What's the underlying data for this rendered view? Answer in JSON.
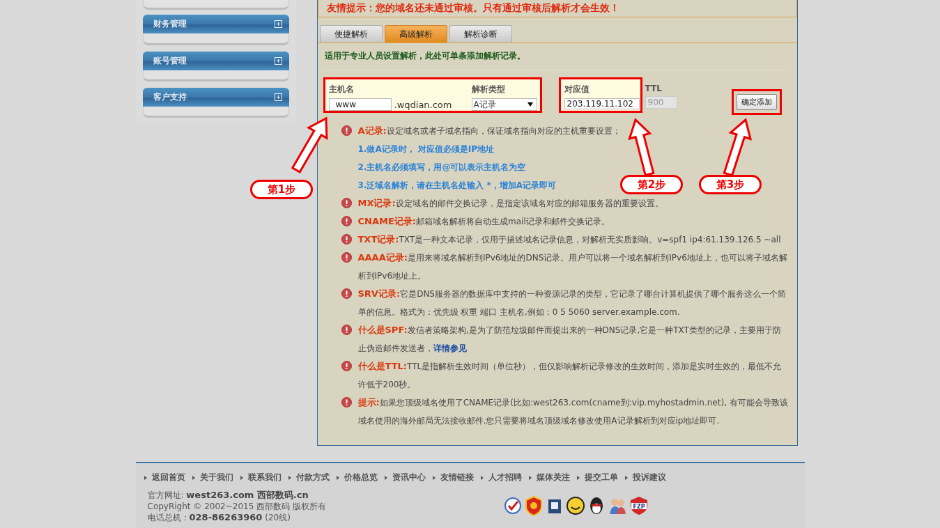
{
  "sidebar": {
    "groups": [
      {
        "title": "财务管理",
        "expanded": false
      },
      {
        "title": "账号管理",
        "expanded": false
      },
      {
        "title": "客户支持",
        "expanded": false
      }
    ]
  },
  "notice": "友情提示：您的域名还未通过审核。只有通过审核后解析才会生效！",
  "tabs": [
    {
      "label": "便捷解析",
      "selected": false
    },
    {
      "label": "高级解析",
      "selected": true
    },
    {
      "label": "解析诊断",
      "selected": false
    }
  ],
  "intro": "适用于专业人员设置解析，此处可单条添加解析记录。",
  "form": {
    "host_label": "主机名",
    "host_value": "www",
    "domain_suffix": ".wqdian.com",
    "type_label": "解析类型",
    "type_value": "A记录",
    "value_label": "对应值",
    "value_value": "203.119.11.102",
    "ttl_label": "TTL",
    "ttl_value": "900",
    "ttl_disabled": true,
    "submit": "确定添加"
  },
  "items": [
    {
      "title": "A记录:",
      "text": "设定域名或者子域名指向，保证域名指向对应的主机重要设置；",
      "notes": [
        "1.做A记录时， 对应值必须是IP地址",
        "2.主机名必须填写，用@可以表示主机名为空",
        "3.泛域名解析，请在主机名处输入 *，增加A记录即可"
      ]
    },
    {
      "title": "MX记录:",
      "text": "设定域名的邮件交换记录，是指定该域名对应的邮箱服务器的重要设置。"
    },
    {
      "title": "CNAME记录:",
      "text": "邮箱域名解析将自动生成mail记录和邮件交换记录。"
    },
    {
      "title": "TXT记录:",
      "text": "TXT是一种文本记录，仅用于描述域名记录信息，对解析无实质影响。v=spf1 ip4:61.139.126.5 ~all"
    },
    {
      "title": "AAAA记录:",
      "text": "是用来将域名解析到IPv6地址的DNS记录。用户可以将一个域名解析到IPv6地址上，也可以将子域名解析到IPv6地址上。"
    },
    {
      "title": "SRV记录:",
      "text": "它是DNS服务器的数据库中支持的一种资源记录的类型，它记录了哪台计算机提供了哪个服务这么一个简单的信息。格式为：优先级 权重 端口 主机名,例如：0 5 5060 server.example.com."
    },
    {
      "title": "什么是SPF:",
      "text": "发信者策略架构,是为了防范垃圾邮件而提出来的一种DNS记录,它是一种TXT类型的记录，主要用于防止伪造邮件发送者，",
      "link": "详情参见"
    },
    {
      "title": "什么是TTL:",
      "text": "TTL是指解析生效时间（单位秒），但仅影响解析记录修改的生效时间，添加是实时生效的，最低不允许低于200秒。"
    },
    {
      "title": "提示:",
      "text": "如果您顶级域名使用了CNAME记录(比如:west263.com(cname到:vip.myhostadmin.net), 有可能会导致该域名使用的海外邮局无法接收邮件.您只需要将域名顶级域名修改使用A记录解析到对应ip地址即可."
    }
  ],
  "steps": [
    "第1步",
    "第2步",
    "第3步"
  ],
  "footer": {
    "links": [
      "返回首页",
      "关于我们",
      "联系我们",
      "付款方式",
      "价格总览",
      "资讯中心",
      "友情链接",
      "人才招聘",
      "媒体关注",
      "提交工单",
      "投诉建议"
    ],
    "info": [
      "官方网址: **west263.com 西部数码.cn**",
      "CopyRight © 2002~2015 西部数码 版权所有",
      "电话总机：**028-86263960** (20线)"
    ],
    "badge_text": "FZP"
  }
}
